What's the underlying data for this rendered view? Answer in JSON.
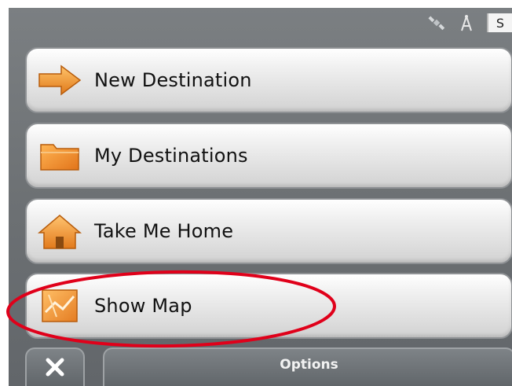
{
  "status": {
    "indicator_text": "S",
    "icons": [
      "satellite-icon",
      "gps-antenna-icon"
    ]
  },
  "menu": {
    "items": [
      {
        "label": "New Destination",
        "icon": "arrow-right-icon"
      },
      {
        "label": "My Destinations",
        "icon": "folder-icon"
      },
      {
        "label": "Take Me Home",
        "icon": "home-icon"
      },
      {
        "label": "Show Map",
        "icon": "map-icon"
      }
    ]
  },
  "bottom_bar": {
    "close_icon": "close-icon",
    "options_label": "Options"
  },
  "colors": {
    "highlight": "#e0001a",
    "icon_orange": "#f39a2a",
    "screen_gray": "#6d7174"
  }
}
